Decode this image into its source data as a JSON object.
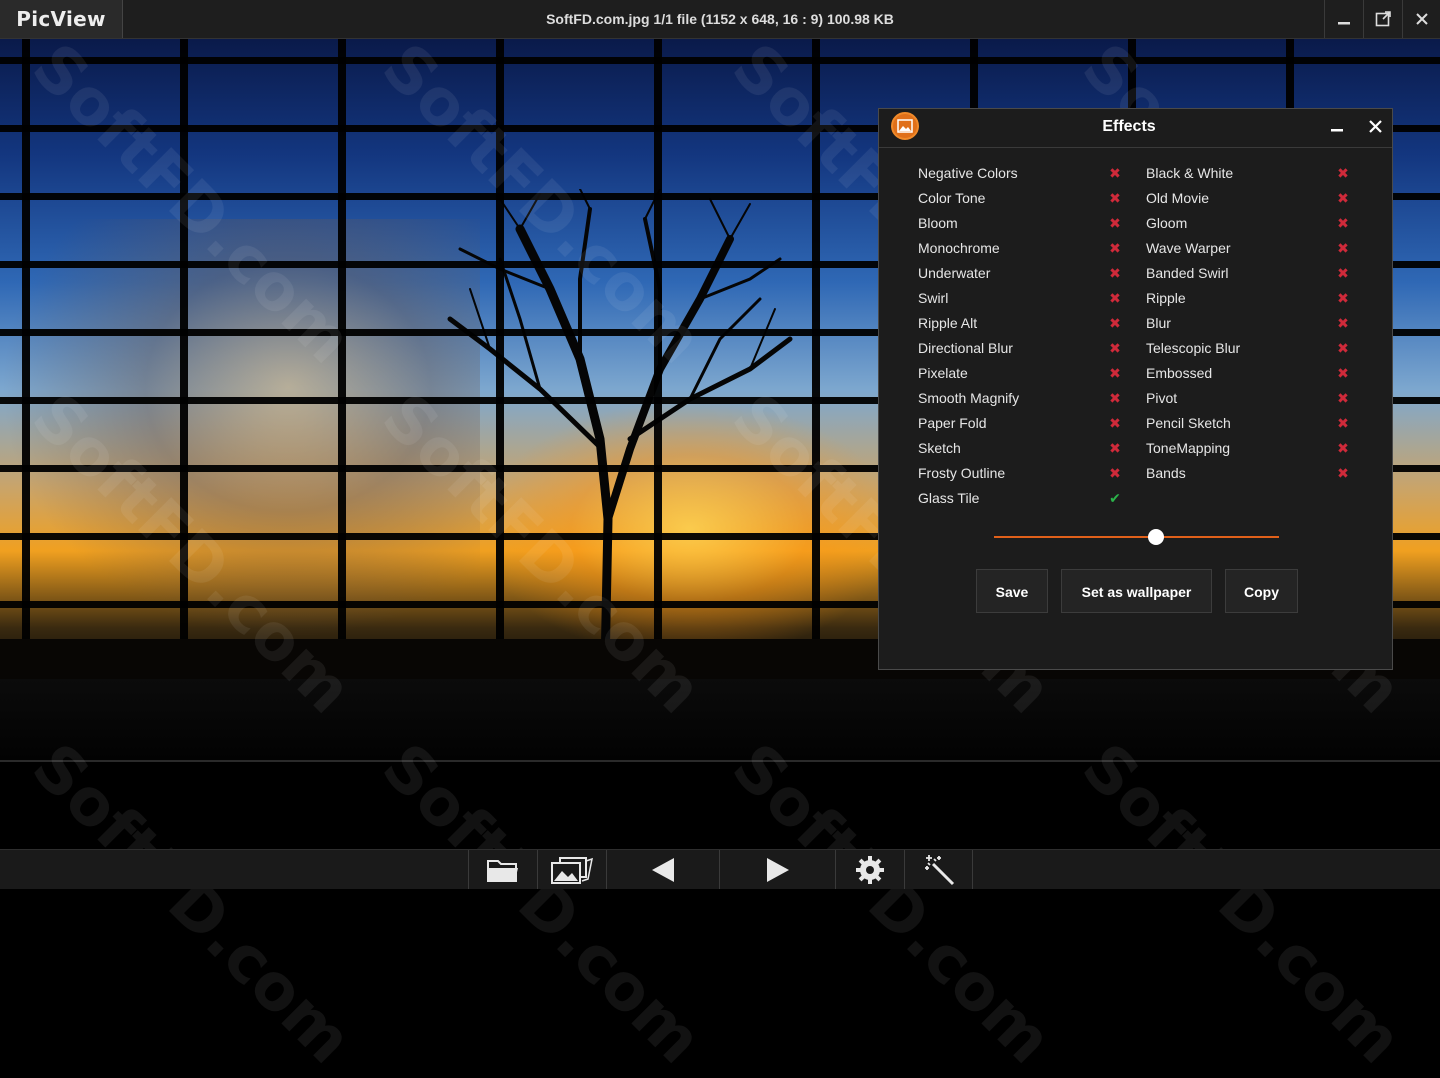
{
  "app": {
    "name": "PicView"
  },
  "window": {
    "title": "SoftFD.com.jpg 1/1 file (1152 x 648, 16 : 9) 100.98 KB"
  },
  "watermark": {
    "text": "SoftFD.com"
  },
  "effects_panel": {
    "title": "Effects",
    "left_effects": [
      {
        "label": "Negative Colors",
        "enabled": false
      },
      {
        "label": "Color Tone",
        "enabled": false
      },
      {
        "label": "Bloom",
        "enabled": false
      },
      {
        "label": "Monochrome",
        "enabled": false
      },
      {
        "label": "Underwater",
        "enabled": false
      },
      {
        "label": "Swirl",
        "enabled": false
      },
      {
        "label": "Ripple Alt",
        "enabled": false
      },
      {
        "label": "Directional Blur",
        "enabled": false
      },
      {
        "label": "Pixelate",
        "enabled": false
      },
      {
        "label": "Smooth Magnify",
        "enabled": false
      },
      {
        "label": "Paper Fold",
        "enabled": false
      },
      {
        "label": "Sketch",
        "enabled": false
      },
      {
        "label": "Frosty Outline",
        "enabled": false
      },
      {
        "label": "Glass Tile",
        "enabled": true
      }
    ],
    "right_effects": [
      {
        "label": "Black & White",
        "enabled": false
      },
      {
        "label": "Old Movie",
        "enabled": false
      },
      {
        "label": "Gloom",
        "enabled": false
      },
      {
        "label": "Wave Warper",
        "enabled": false
      },
      {
        "label": "Banded Swirl",
        "enabled": false
      },
      {
        "label": "Ripple",
        "enabled": false
      },
      {
        "label": "Blur",
        "enabled": false
      },
      {
        "label": "Telescopic Blur",
        "enabled": false
      },
      {
        "label": "Embossed",
        "enabled": false
      },
      {
        "label": "Pivot",
        "enabled": false
      },
      {
        "label": "Pencil Sketch",
        "enabled": false
      },
      {
        "label": "ToneMapping",
        "enabled": false
      },
      {
        "label": "Bands",
        "enabled": false
      }
    ],
    "intensity_fraction": 0.57,
    "buttons": {
      "save": "Save",
      "wallpaper": "Set as wallpaper",
      "copy": "Copy"
    },
    "icons": {
      "off": "✖",
      "on": "✔"
    }
  },
  "colors": {
    "accent": "#e0601a",
    "off": "#d02a3a",
    "on": "#2bb34a"
  }
}
